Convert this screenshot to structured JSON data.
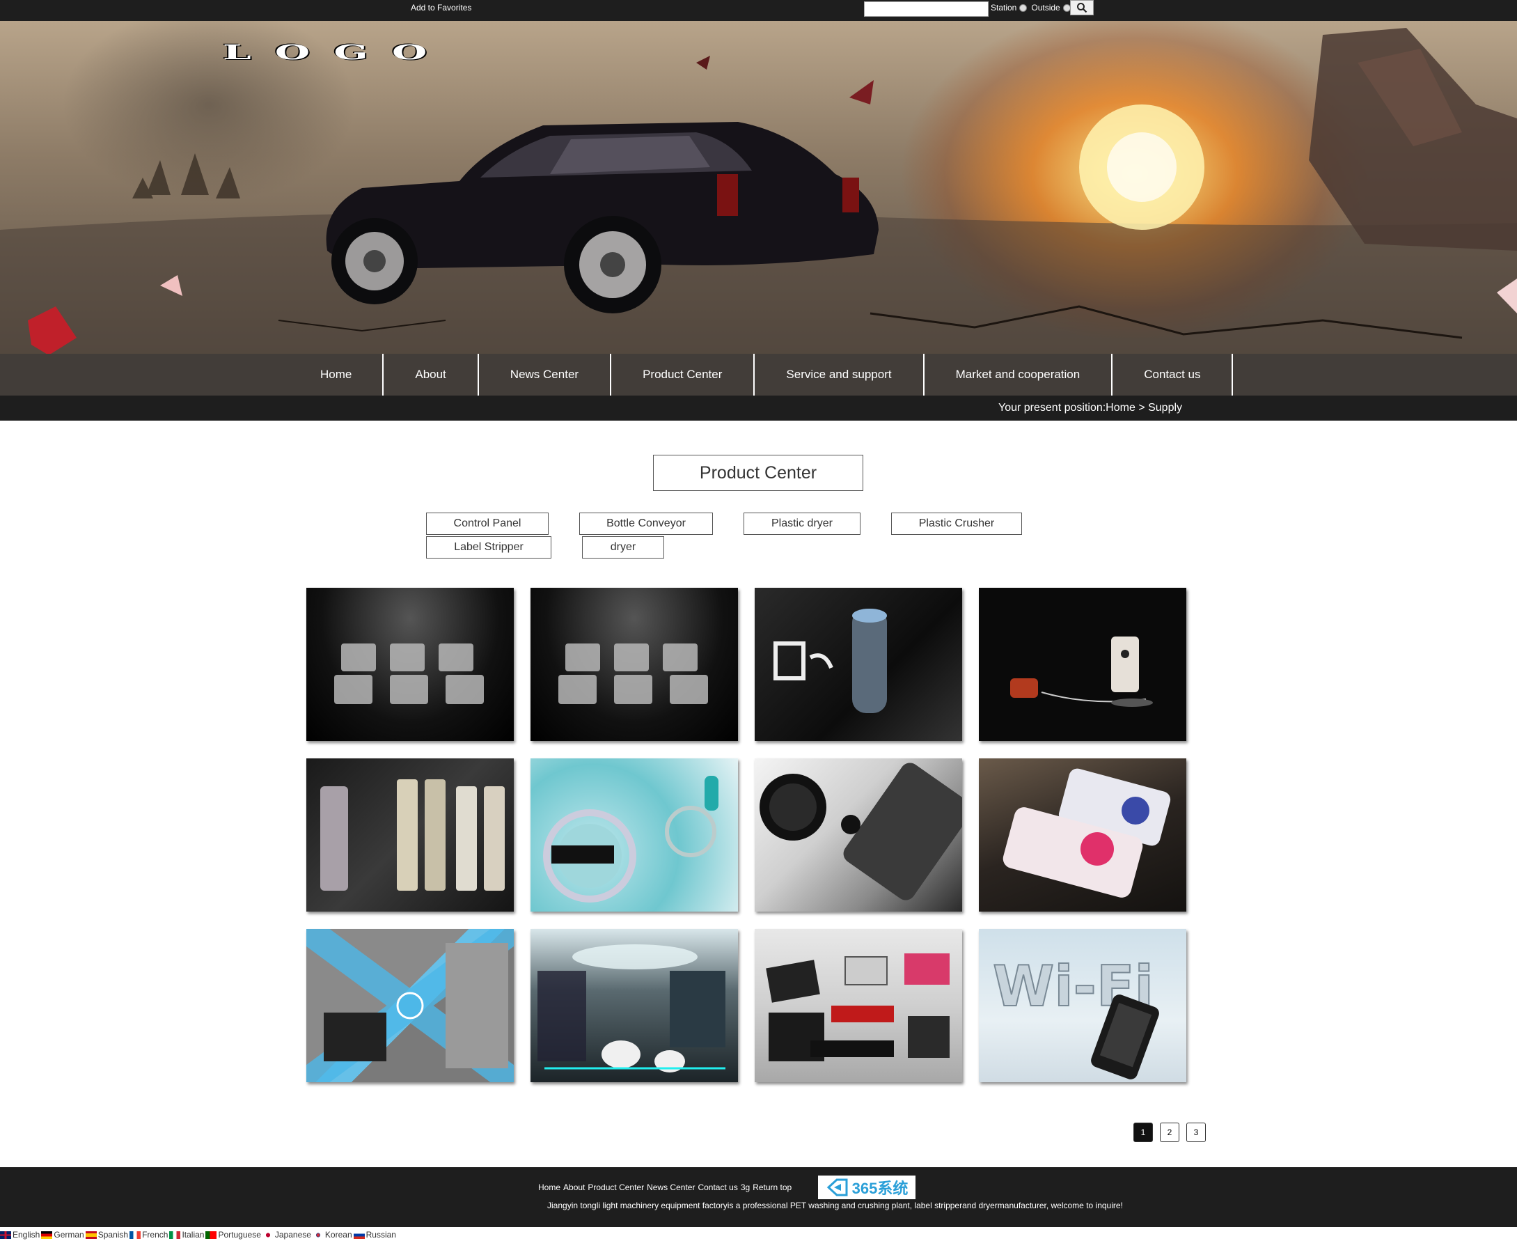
{
  "topbar": {
    "favorites": "Add to Favorites",
    "search_value": "",
    "radio_station": "Station",
    "radio_outside": "Outside"
  },
  "banner": {
    "logo": "LOGO"
  },
  "nav": [
    "Home",
    "About",
    "News Center",
    "Product Center",
    "Service and support",
    "Market and cooperation",
    "Contact us"
  ],
  "breadcrumb": "Your present position:Home > Supply",
  "section_title": "Product Center",
  "categories": [
    "Control Panel",
    "Bottle Conveyor",
    "Plastic dryer",
    "Plastic Crusher",
    "Label Stripper",
    "dryer"
  ],
  "pagination": [
    "1",
    "2",
    "3"
  ],
  "footer": {
    "links": [
      "Home",
      "About",
      "Product Center",
      "News Center",
      "Contact us",
      "3g",
      "Return top"
    ],
    "logo_text": "365系统",
    "copyright": "Jiangyin tongli light machinery equipment factoryis a professional PET washing and crushing plant, label stripperand dryermanufacturer, welcome to inquire!"
  },
  "languages": [
    "English",
    "German",
    "Spanish",
    "French",
    "Italian",
    "Portuguese",
    "Japanese",
    "Korean",
    "Russian"
  ]
}
